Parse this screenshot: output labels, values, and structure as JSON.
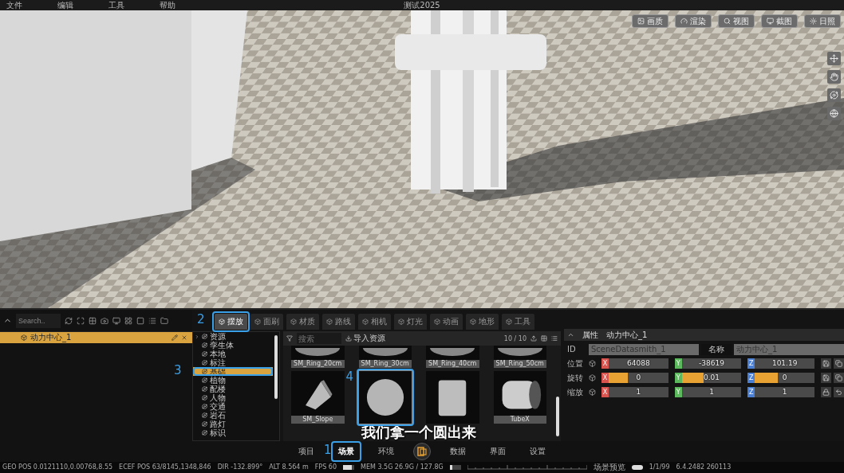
{
  "menu_bar": {
    "items": [
      "文件",
      "编辑",
      "工具",
      "帮助"
    ],
    "title": "测试2025"
  },
  "viewport": {
    "view_buttons": [
      "画质",
      "渲染",
      "视图",
      "截图",
      "日照"
    ]
  },
  "outliner": {
    "search_placeholder": "Search..",
    "items": [
      {
        "label": "动力中心_1",
        "selected": true
      }
    ]
  },
  "tabs": [
    {
      "label": "摆放",
      "selected": true,
      "callout": "2"
    },
    {
      "label": "面刷",
      "selected": false
    },
    {
      "label": "材质",
      "selected": false
    },
    {
      "label": "路线",
      "selected": false
    },
    {
      "label": "相机",
      "selected": false
    },
    {
      "label": "灯光",
      "selected": false
    },
    {
      "label": "动画",
      "selected": false
    },
    {
      "label": "地形",
      "selected": false
    },
    {
      "label": "工具",
      "selected": false
    }
  ],
  "categories": [
    {
      "label": "资源",
      "selected": false,
      "has_children": true
    },
    {
      "label": "孪生体",
      "selected": false,
      "has_children": false
    },
    {
      "label": "本地",
      "selected": false,
      "has_children": false
    },
    {
      "label": "标注",
      "selected": false,
      "has_children": false
    },
    {
      "label": "基础",
      "selected": true,
      "has_children": false,
      "callout": "3"
    },
    {
      "label": "植物",
      "selected": false,
      "has_children": false
    },
    {
      "label": "配楼",
      "selected": false,
      "has_children": false
    },
    {
      "label": "人物",
      "selected": false,
      "has_children": false
    },
    {
      "label": "交通",
      "selected": false,
      "has_children": false
    },
    {
      "label": "岩石",
      "selected": false,
      "has_children": false
    },
    {
      "label": "路灯",
      "selected": false,
      "has_children": false
    },
    {
      "label": "标识",
      "selected": false,
      "has_children": false
    }
  ],
  "assets": {
    "search_placeholder": "搜索",
    "import_label": "导入资源",
    "count": "10 / 10",
    "items": [
      {
        "name": "SM_Ring_20cm",
        "kind": "ring",
        "selected": false
      },
      {
        "name": "SM_Ring_30cm",
        "kind": "ring",
        "selected": false
      },
      {
        "name": "SM_Ring_40cm",
        "kind": "ring",
        "selected": false
      },
      {
        "name": "SM_Ring_50cm",
        "kind": "ring",
        "selected": false
      },
      {
        "name": "SM_Slope",
        "kind": "slope",
        "selected": false
      },
      {
        "kind": "sphere",
        "selected": true,
        "callout": "4"
      },
      {
        "kind": "cylinder",
        "selected": false
      },
      {
        "name": "TubeX",
        "kind": "tube",
        "selected": false
      }
    ]
  },
  "subtitle": "我们拿一个圆出来",
  "properties": {
    "title": "属性",
    "object_name": "动力中心_1",
    "id_label": "ID",
    "id_value": "SceneDatasmith_1",
    "name_label": "名称",
    "name_value": "动力中心_1",
    "rows": [
      {
        "label": "位置",
        "kind": "plain",
        "fields": [
          {
            "axis": "X",
            "value": "64088",
            "color": "#d9534f"
          },
          {
            "axis": "Y",
            "value": "-38619",
            "color": "#5cb85c"
          },
          {
            "axis": "Z",
            "value": "101.19",
            "color": "#4a7fd4"
          }
        ]
      },
      {
        "label": "旋转",
        "kind": "slider",
        "fields": [
          {
            "axis": "X",
            "value": "0",
            "level": 0.4,
            "color": "#d9534f"
          },
          {
            "axis": "Y",
            "value": "0.01",
            "level": 0.43,
            "color": "#5cb85c"
          },
          {
            "axis": "Z",
            "value": "0",
            "level": 0.45,
            "color": "#4a7fd4"
          }
        ]
      },
      {
        "label": "缩放",
        "kind": "scale",
        "fields": [
          {
            "axis": "X",
            "value": "1",
            "color": "#d9534f"
          },
          {
            "axis": "Y",
            "value": "1",
            "color": "#5cb85c"
          },
          {
            "axis": "Z",
            "value": "1",
            "color": "#4a7fd4"
          }
        ]
      }
    ]
  },
  "nav": [
    {
      "kind": "text",
      "label": "项目",
      "selected": false
    },
    {
      "kind": "text",
      "label": "场景",
      "selected": true,
      "callout": "1"
    },
    {
      "kind": "text",
      "label": "环境",
      "selected": false
    },
    {
      "kind": "logo"
    },
    {
      "kind": "text",
      "label": "数据",
      "selected": false
    },
    {
      "kind": "text",
      "label": "界面",
      "selected": false
    },
    {
      "kind": "text",
      "label": "设置",
      "selected": false
    }
  ],
  "status_bar": {
    "left": [
      {
        "label": "GEO POS",
        "value": "0.0121110,0.00768,8.55"
      },
      {
        "label": "ECEF POS",
        "value": "63/8145,1348,846"
      },
      {
        "label": "DIR",
        "value": "-132.899°"
      },
      {
        "label": "ALT",
        "value": "8.564 m"
      },
      {
        "label": "FPS",
        "value": "60",
        "level": 0.8
      },
      {
        "label": "MEM",
        "value": "3.5G  26.9G / 127.8G",
        "level": 0.2
      }
    ],
    "right": {
      "preview_label": "场景预览",
      "preview_on": true,
      "frame": "1/1/99",
      "version": "6.4.2482 260113"
    }
  }
}
